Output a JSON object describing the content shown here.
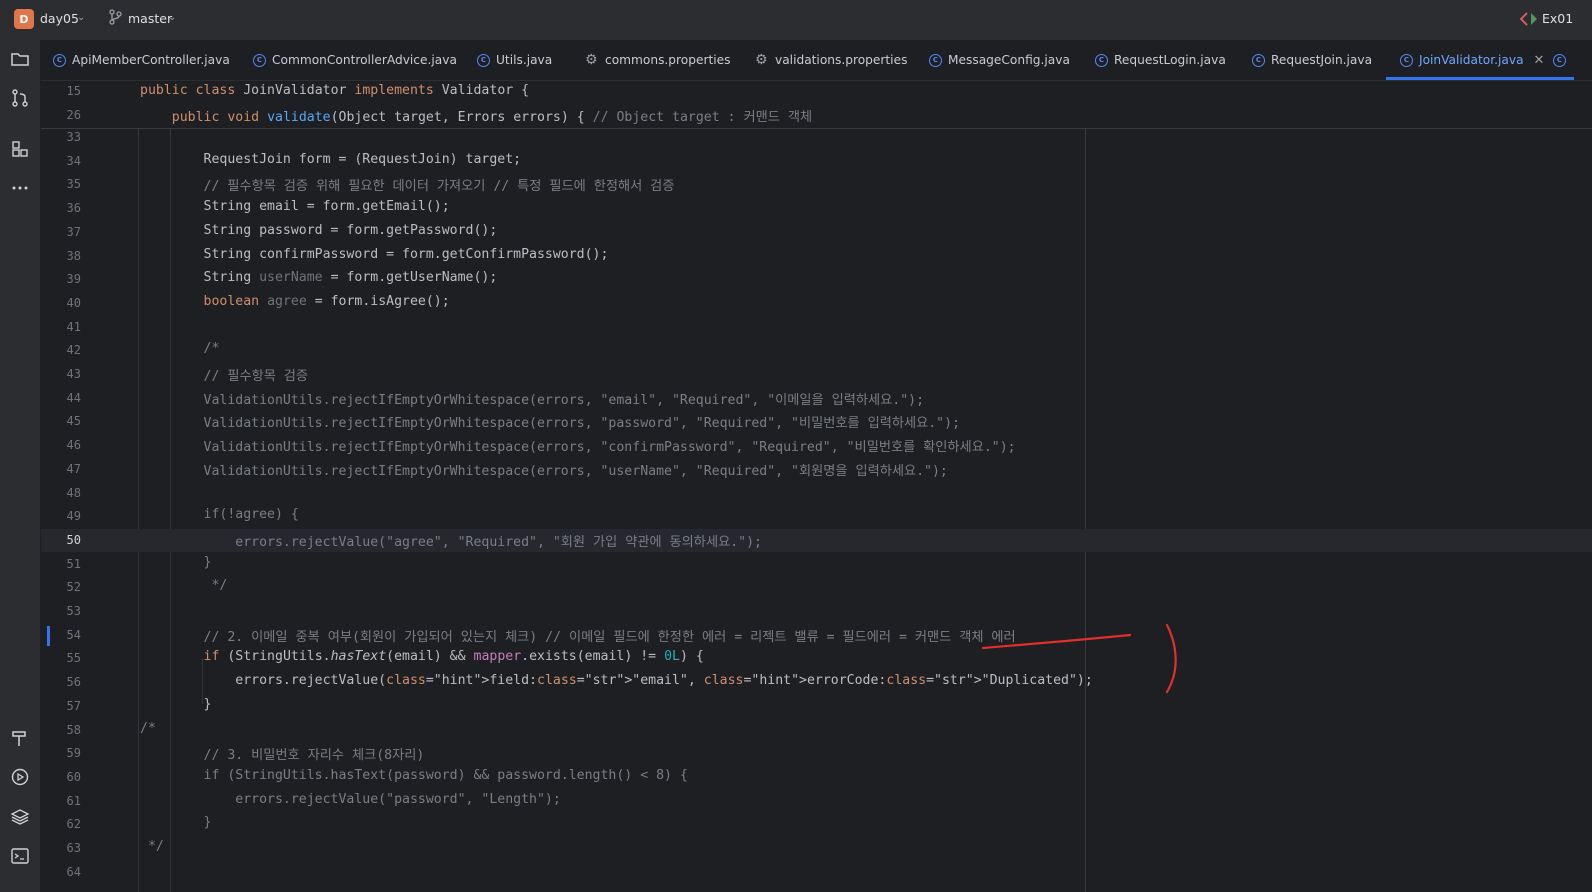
{
  "titlebar": {
    "project_initial": "D",
    "project_name": "day05",
    "branch": "master",
    "run_config": "Ex01"
  },
  "tabs": [
    {
      "label": "ApiMemberController.java",
      "kind": "java",
      "active": false
    },
    {
      "label": "CommonControllerAdvice.java",
      "kind": "java",
      "active": false
    },
    {
      "label": "Utils.java",
      "kind": "java",
      "active": false
    },
    {
      "label": "commons.properties",
      "kind": "properties",
      "active": false
    },
    {
      "label": "validations.properties",
      "kind": "properties",
      "active": false
    },
    {
      "label": "MessageConfig.java",
      "kind": "java",
      "active": false
    },
    {
      "label": "RequestLogin.java",
      "kind": "java",
      "active": false
    },
    {
      "label": "RequestJoin.java",
      "kind": "java",
      "active": false
    },
    {
      "label": "JoinValidator.java",
      "kind": "java",
      "active": true
    }
  ],
  "toolstrip": {
    "top_icons": [
      "folder-icon",
      "git-commit-icon",
      "structure-icon",
      "more-icon"
    ],
    "bottom_icons": [
      "build-icon",
      "run-icon",
      "layers-icon",
      "terminal-icon"
    ]
  },
  "editor": {
    "sticky": [
      {
        "num": "15",
        "text": "public class JoinValidator implements Validator {"
      },
      {
        "num": "26",
        "text": "    public void validate(Object target, Errors errors) { // Object target : 커맨드 객체"
      }
    ],
    "current_line": "50",
    "lines": [
      {
        "num": "33",
        "text": ""
      },
      {
        "num": "34",
        "text": "        RequestJoin form = (RequestJoin) target;"
      },
      {
        "num": "35",
        "text": "        // 필수항목 검증 위해 필요한 데이터 가져오기 // 특정 필드에 한정해서 검증"
      },
      {
        "num": "36",
        "text": "        String email = form.getEmail();"
      },
      {
        "num": "37",
        "text": "        String password = form.getPassword();"
      },
      {
        "num": "38",
        "text": "        String confirmPassword = form.getConfirmPassword();"
      },
      {
        "num": "39",
        "text": "        String userName = form.getUserName();"
      },
      {
        "num": "40",
        "text": "        boolean agree = form.isAgree();"
      },
      {
        "num": "41",
        "text": ""
      },
      {
        "num": "42",
        "text": "        /*"
      },
      {
        "num": "43",
        "text": "        // 필수항목 검증"
      },
      {
        "num": "44",
        "text": "        ValidationUtils.rejectIfEmptyOrWhitespace(errors, \"email\", \"Required\", \"이메일을 입력하세요.\");"
      },
      {
        "num": "45",
        "text": "        ValidationUtils.rejectIfEmptyOrWhitespace(errors, \"password\", \"Required\", \"비밀번호를 입력하세요.\");"
      },
      {
        "num": "46",
        "text": "        ValidationUtils.rejectIfEmptyOrWhitespace(errors, \"confirmPassword\", \"Required\", \"비밀번호를 확인하세요.\");"
      },
      {
        "num": "47",
        "text": "        ValidationUtils.rejectIfEmptyOrWhitespace(errors, \"userName\", \"Required\", \"회원명을 입력하세요.\");"
      },
      {
        "num": "48",
        "text": ""
      },
      {
        "num": "49",
        "text": "        if(!agree) {"
      },
      {
        "num": "50",
        "text": "            errors.rejectValue(\"agree\", \"Required\", \"회원 가입 약관에 동의하세요.\");"
      },
      {
        "num": "51",
        "text": "        }"
      },
      {
        "num": "52",
        "text": "         */"
      },
      {
        "num": "53",
        "text": ""
      },
      {
        "num": "54",
        "text": "        // 2. 이메일 중복 여부(회원이 가입되어 있는지 체크) // 이메일 필드에 한정한 에러 = 리젝트 밸류 = 필드에러 = 커맨드 객체 에러"
      },
      {
        "num": "55",
        "text": "        if (StringUtils.hasText(email) && mapper.exists(email) != 0L) {"
      },
      {
        "num": "56",
        "text": "            errors.rejectValue(field: \"email\", errorCode: \"Duplicated\");"
      },
      {
        "num": "57",
        "text": "        }"
      },
      {
        "num": "58",
        "text": "/*"
      },
      {
        "num": "59",
        "text": "        // 3. 비밀번호 자리수 체크(8자리)"
      },
      {
        "num": "60",
        "text": "        if (StringUtils.hasText(password) && password.length() < 8) {"
      },
      {
        "num": "61",
        "text": "            errors.rejectValue(\"password\", \"Length\");"
      },
      {
        "num": "62",
        "text": "        }"
      },
      {
        "num": "63",
        "text": " */"
      },
      {
        "num": "64",
        "text": ""
      }
    ],
    "tokens": {
      "kw_public": "public",
      "kw_class": "class",
      "kw_implements": "implements",
      "kw_void": "void",
      "kw_boolean": "boolean",
      "kw_if": "if",
      "hint_field": "field:",
      "hint_errorCode": "errorCode:"
    }
  },
  "colors": {
    "background": "#1e1f22",
    "panel": "#2b2d30",
    "accent": "#3574f0",
    "keyword": "#cf8e6d",
    "function": "#56a8f5",
    "string": "#6aab73",
    "comment": "#7a7e85",
    "annotation_pen": "#e0302a"
  }
}
